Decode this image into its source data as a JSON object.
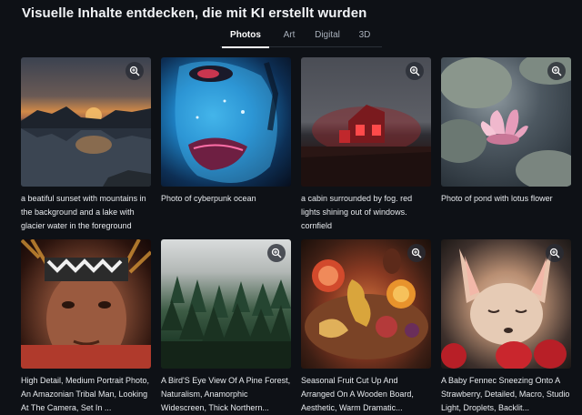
{
  "page": {
    "title": "Visuelle Inhalte entdecken, die mit KI erstellt wurden"
  },
  "tabs": [
    {
      "label": "Photos",
      "active": true
    },
    {
      "label": "Art",
      "active": false
    },
    {
      "label": "Digital",
      "active": false
    },
    {
      "label": "3D",
      "active": false
    }
  ],
  "gallery": {
    "items": [
      {
        "caption": "a beatiful sunset with mountains in the background and a lake with glacier water in the foreground",
        "icon": "zoom-in-icon"
      },
      {
        "caption": "Photo of cyberpunk ocean",
        "icon": "zoom-in-icon"
      },
      {
        "caption": "a cabin surrounded by fog. red lights shining out of windows. cornfield",
        "icon": "zoom-in-icon"
      },
      {
        "caption": "Photo of pond with lotus flower",
        "icon": "zoom-in-icon"
      },
      {
        "caption": "High Detail, Medium Portrait Photo, An Amazonian Tribal Man, Looking At The Camera, Set In ...",
        "icon": "zoom-in-icon"
      },
      {
        "caption": "A Bird'S Eye View Of A Pine Forest, Naturalism, Anamorphic Widescreen, Thick Northern...",
        "icon": "zoom-in-icon"
      },
      {
        "caption": "Seasonal Fruit Cut Up And Arranged On A Wooden Board, Aesthetic, Warm Dramatic...",
        "icon": "zoom-in-icon"
      },
      {
        "caption": "A Baby Fennec Sneezing Onto A Strawberry, Detailed, Macro, Studio Light, Droplets, Backlit...",
        "icon": "zoom-in-icon"
      }
    ]
  },
  "colors": {
    "background": "#0e1116",
    "text": "#ffffff",
    "muted_text": "#a8b0bb"
  }
}
